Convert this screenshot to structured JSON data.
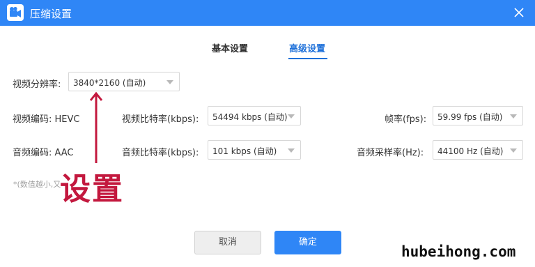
{
  "window": {
    "title": "压缩设置",
    "app_icon": "camera-icon",
    "close_icon": "close-icon",
    "accent": "#2f86f6"
  },
  "tabs": [
    {
      "label": "基本设置",
      "active": false
    },
    {
      "label": "高级设置",
      "active": true
    }
  ],
  "resolution": {
    "label": "视频分辨率:",
    "value": "3840*2160 (自动)"
  },
  "video": {
    "codec_label": "视频编码: HEVC",
    "bitrate_label": "视频比特率(kbps):",
    "bitrate_value": "54494 kbps (自动)",
    "fps_label": "帧率(fps):",
    "fps_value": "59.99 fps (自动)"
  },
  "audio": {
    "codec_label": "音频编码: AAC",
    "bitrate_label": "音频比特率(kbps):",
    "bitrate_value": "101 kbps (自动)",
    "samplerate_label": "音频采样率(Hz):",
    "samplerate_value": "44100 Hz (自动)"
  },
  "note": "*(数值越小,又",
  "annotation": {
    "text": "设置",
    "color": "#c3183e"
  },
  "buttons": {
    "cancel": "取消",
    "ok": "确定"
  },
  "watermark": "hubeihong.com"
}
